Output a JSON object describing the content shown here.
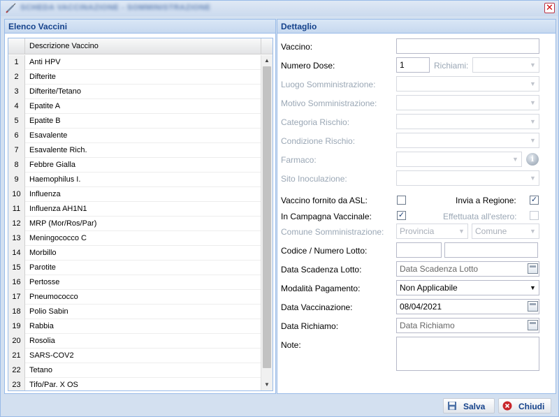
{
  "window": {
    "title": "SCHEDA VACCINAZIONE - SOMMINISTRAZIONE",
    "close_symbol": "✕",
    "icons": {
      "app": "syringe-icon",
      "close": "close-icon"
    }
  },
  "left_panel": {
    "title": "Elenco Vaccini",
    "column_header": "Descrizione Vaccino",
    "rows": [
      {
        "num": "1",
        "desc": "Anti HPV"
      },
      {
        "num": "2",
        "desc": "Difterite"
      },
      {
        "num": "3",
        "desc": "Difterite/Tetano"
      },
      {
        "num": "4",
        "desc": "Epatite A"
      },
      {
        "num": "5",
        "desc": "Epatite B"
      },
      {
        "num": "6",
        "desc": "Esavalente"
      },
      {
        "num": "7",
        "desc": "Esavalente Rich."
      },
      {
        "num": "8",
        "desc": "Febbre Gialla"
      },
      {
        "num": "9",
        "desc": "Haemophilus I."
      },
      {
        "num": "10",
        "desc": "Influenza"
      },
      {
        "num": "11",
        "desc": "Influenza AH1N1"
      },
      {
        "num": "12",
        "desc": "MRP (Mor/Ros/Par)"
      },
      {
        "num": "13",
        "desc": "Meningococco C"
      },
      {
        "num": "14",
        "desc": "Morbillo"
      },
      {
        "num": "15",
        "desc": "Parotite"
      },
      {
        "num": "16",
        "desc": "Pertosse"
      },
      {
        "num": "17",
        "desc": "Pneumococco"
      },
      {
        "num": "18",
        "desc": "Polio Sabin"
      },
      {
        "num": "19",
        "desc": "Rabbia"
      },
      {
        "num": "20",
        "desc": "Rosolia"
      },
      {
        "num": "21",
        "desc": "SARS-COV2"
      },
      {
        "num": "22",
        "desc": "Tetano"
      },
      {
        "num": "23",
        "desc": "Tifo/Par. X OS"
      }
    ],
    "scroll_up_symbol": "▲",
    "scroll_down_symbol": "▼"
  },
  "right_panel": {
    "title": "Dettaglio",
    "labels": {
      "vaccino": "Vaccino:",
      "numero_dosi": "Numero Dose:",
      "richiami": "Richiami:",
      "luogo": "Luogo Somministrazione:",
      "motivo": "Motivo Somministrazione:",
      "categoria": "Categoria Rischio:",
      "condizione": "Condizione Rischio:",
      "farmaco": "Farmaco:",
      "sito": "Sito Inoculazione:",
      "fornito_asl": "Vaccino fornito da ASL:",
      "invia_regione": "Invia a Regione:",
      "campagna": "In Campagna Vaccinale:",
      "estero": "Effettuata all'estero:",
      "comune_somm": "Comune Somministrazione:",
      "lotto": "Codice / Numero Lotto:",
      "scadenza": "Data Scadenza Lotto:",
      "pagamento": "Modalità Pagamento:",
      "data_vacc": "Data Vaccinazione:",
      "data_richiamo": "Data Richiamo:",
      "note": "Note:"
    },
    "values": {
      "vaccino": "",
      "numero_dosi": "1",
      "provincia_placeholder": "Provincia",
      "comune_placeholder": "Comune",
      "scadenza_placeholder": "Data Scadenza Lotto",
      "pagamento": "Non Applicabile",
      "data_vacc": "08/04/2021",
      "data_richiamo_placeholder": "Data Richiamo"
    },
    "checkboxes": {
      "fornito_asl": false,
      "invia_regione": true,
      "campagna": true,
      "estero": false
    },
    "check_symbol": "✓",
    "combo_symbol": "▼",
    "info_symbol": "i",
    "icons": {
      "info": "info-icon",
      "calendar": "calendar-icon",
      "dropdown": "chevron-down-icon"
    }
  },
  "footer": {
    "save_label": "Salva",
    "close_label": "Chiudi",
    "icons": {
      "save": "floppy-disk-icon",
      "close": "cancel-circle-icon"
    }
  },
  "colors": {
    "panel_header_text": "#15428b",
    "border": "#99bbe8",
    "window_bg": "#d3e0f0"
  }
}
